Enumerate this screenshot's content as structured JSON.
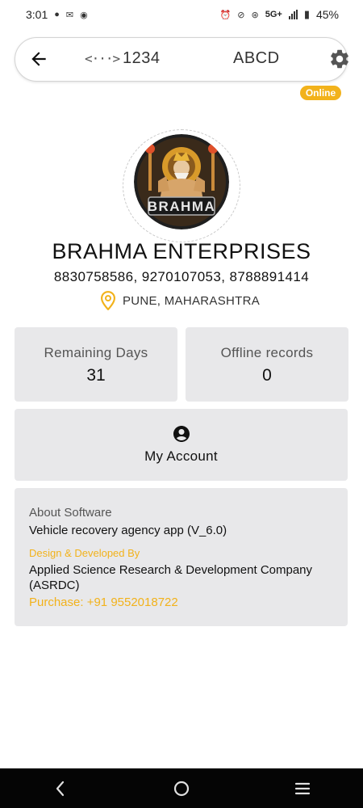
{
  "status_bar": {
    "time": "3:01",
    "network": "5G+",
    "battery": "45%"
  },
  "top_bar": {
    "code": "1234",
    "name": "ABCD"
  },
  "badge": {
    "status": "Online"
  },
  "logo": {
    "text": "BRAHMA"
  },
  "profile": {
    "company": "BRAHMA ENTERPRISES",
    "phones": "8830758586, 9270107053, 8788891414",
    "location": "PUNE, MAHARASHTRA"
  },
  "stats": {
    "remaining_label": "Remaining Days",
    "remaining_value": "31",
    "offline_label": "Offline records",
    "offline_value": "0"
  },
  "account": {
    "label": "My Account"
  },
  "about": {
    "title": "About Software",
    "app": "Vehicle recovery agency app (V_6.0)",
    "design_label": "Design & Developed By",
    "company": "Applied Science Research & Development Company (ASRDC)",
    "purchase": "Purchase: +91 9552018722"
  },
  "colors": {
    "accent": "#f2b21b",
    "card_bg": "#e8e8ea",
    "nav_bg": "#050505"
  },
  "icons": [
    "back-arrow-icon",
    "code-icon",
    "gear-icon",
    "location-pin-icon",
    "account-circle-icon",
    "nav-back-icon",
    "nav-home-icon",
    "nav-recents-icon"
  ]
}
